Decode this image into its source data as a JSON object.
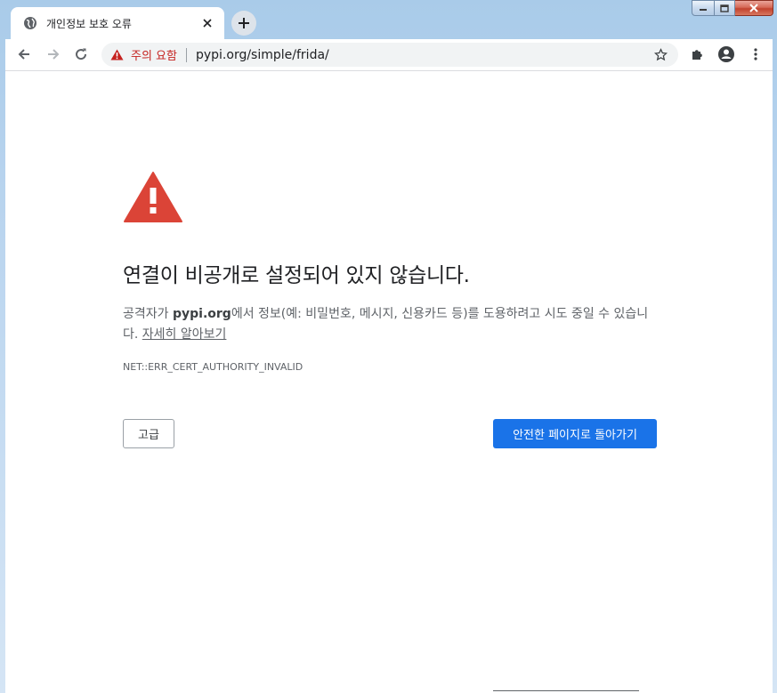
{
  "tab": {
    "title": "개인정보 보호 오류",
    "favicon": "globe-icon",
    "close_glyph": "✕"
  },
  "omnibox": {
    "warning_label": "주의 요함",
    "url": "pypi.org/simple/frida/"
  },
  "page": {
    "heading": "연결이 비공개로 설정되어 있지 않습니다.",
    "description_prefix": "공격자가 ",
    "description_domain": "pypi.org",
    "description_suffix": "에서 정보(예: 비밀번호, 메시지, 신용카드 등)를 도용하려고 시도 중일 수 있습니다. ",
    "learn_more_link": "자세히 알아보기",
    "error_code": "NET::ERR_CERT_AUTHORITY_INVALID"
  },
  "buttons": {
    "advanced_label": "고급",
    "back_to_safety_label": "안전한 페이지로 돌아가기"
  },
  "colors": {
    "warning_red": "#db4437",
    "primary_blue": "#1a73e8",
    "text_secondary": "#5f6368",
    "omnibox_warning_text": "#c5221f"
  }
}
